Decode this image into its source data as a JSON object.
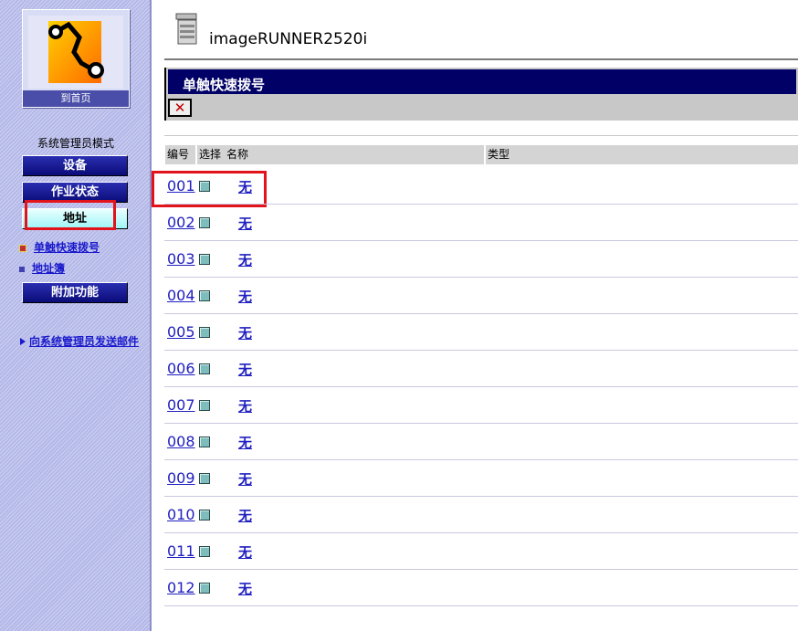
{
  "sidebar": {
    "home_label": "到首页",
    "mode_title": "系统管理员模式",
    "nav": [
      {
        "label": "设备"
      },
      {
        "label": "作业状态"
      },
      {
        "label": "地址"
      }
    ],
    "sub_links": [
      {
        "label": "单触快速拨号",
        "bullet_color": "#c03030"
      },
      {
        "label": "地址簿",
        "bullet_color": "#4040b0"
      }
    ],
    "extra_button": "附加功能",
    "mail_link": "向系统管理员发送邮件",
    "active_nav": "地址"
  },
  "device": {
    "name": "imageRUNNER2520i",
    "icon": "printer-icon"
  },
  "panel": {
    "title": "单触快速拨号",
    "close_icon": "close-icon"
  },
  "table": {
    "headers": {
      "number": "编号",
      "select": "选择",
      "name": "名称",
      "type": "类型"
    },
    "rows": [
      {
        "number": "001",
        "name": "无"
      },
      {
        "number": "002",
        "name": "无"
      },
      {
        "number": "003",
        "name": "无"
      },
      {
        "number": "004",
        "name": "无"
      },
      {
        "number": "005",
        "name": "无"
      },
      {
        "number": "006",
        "name": "无"
      },
      {
        "number": "007",
        "name": "无"
      },
      {
        "number": "008",
        "name": "无"
      },
      {
        "number": "009",
        "name": "无"
      },
      {
        "number": "010",
        "name": "无"
      },
      {
        "number": "011",
        "name": "无"
      },
      {
        "number": "012",
        "name": "无"
      }
    ]
  },
  "colors": {
    "accent": "#000066",
    "link": "#2020c0",
    "highlight": "#e2131a"
  }
}
